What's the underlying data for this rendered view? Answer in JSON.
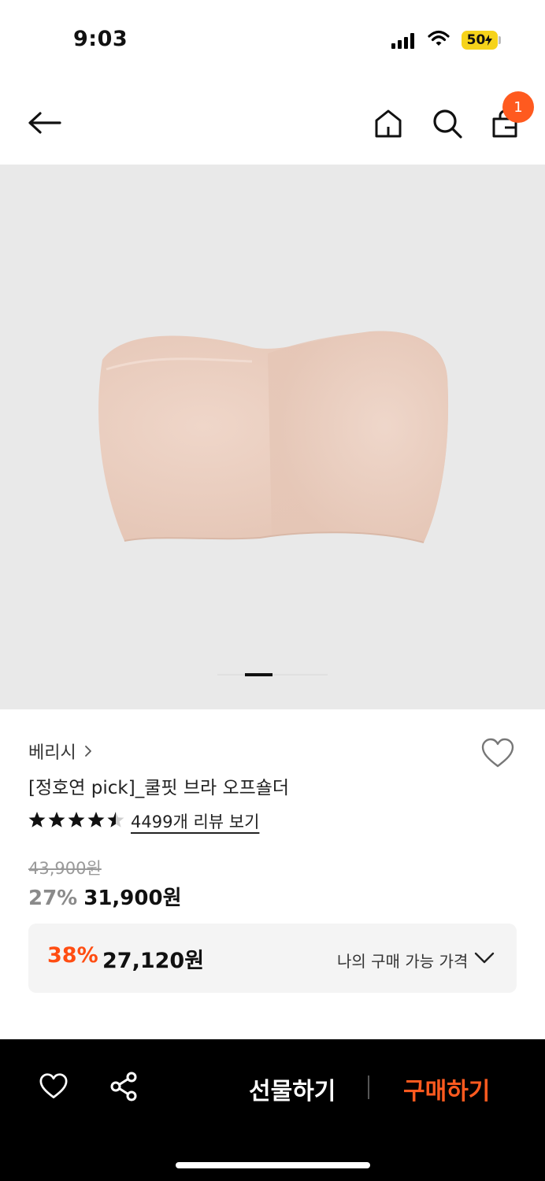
{
  "status_bar": {
    "time": "9:03",
    "battery": "50"
  },
  "nav": {
    "cart_count": "1"
  },
  "product": {
    "brand": "베리시",
    "title": "[정호연 pick]_쿨핏 브라 오프숄더",
    "rating": 4.5,
    "review_link": "4499개 리뷰 보기",
    "original_price": "43,900원",
    "discount": "27%",
    "price": "31,900원",
    "image_index": 1
  },
  "my_price": {
    "discount": "38%",
    "price": "27,120원",
    "label": "나의 구매 가능 가격"
  },
  "bottom_bar": {
    "gift_label": "선물하기",
    "buy_label": "구매하기"
  },
  "colors": {
    "accent": "#ff5a1f",
    "image_bg": "#e9e9e9",
    "product_tone": "#ecd3c6"
  }
}
